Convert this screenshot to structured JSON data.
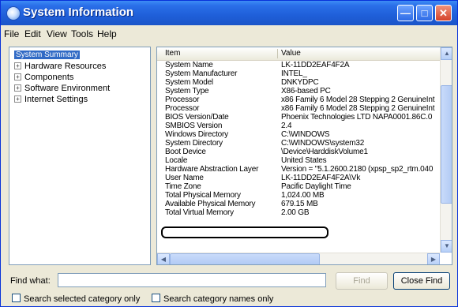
{
  "window": {
    "title": "System Information"
  },
  "menu": [
    "File",
    "Edit",
    "View",
    "Tools",
    "Help"
  ],
  "tree": {
    "root": "System Summary",
    "items": [
      "Hardware Resources",
      "Components",
      "Software Environment",
      "Internet Settings"
    ]
  },
  "table": {
    "headers": {
      "item": "Item",
      "value": "Value"
    },
    "rows": [
      {
        "item": "System Name",
        "value": "LK-11DD2EAF4F2A"
      },
      {
        "item": "System Manufacturer",
        "value": "INTEL_"
      },
      {
        "item": "System Model",
        "value": "DNKYDPC"
      },
      {
        "item": "System Type",
        "value": "X86-based PC"
      },
      {
        "item": "Processor",
        "value": "x86 Family 6 Model 28 Stepping 2 GenuineInt"
      },
      {
        "item": "Processor",
        "value": "x86 Family 6 Model 28 Stepping 2 GenuineInt"
      },
      {
        "item": "BIOS Version/Date",
        "value": "Phoenix Technologies LTD NAPA0001.86C.0"
      },
      {
        "item": "SMBIOS Version",
        "value": "2.4"
      },
      {
        "item": "Windows Directory",
        "value": "C:\\WINDOWS"
      },
      {
        "item": "System Directory",
        "value": "C:\\WINDOWS\\system32"
      },
      {
        "item": "Boot Device",
        "value": "\\Device\\HarddiskVolume1"
      },
      {
        "item": "Locale",
        "value": "United States"
      },
      {
        "item": "Hardware Abstraction Layer",
        "value": "Version = \"5.1.2600.2180 (xpsp_sp2_rtm.040"
      },
      {
        "item": "User Name",
        "value": "LK-11DD2EAF4F2A\\Vk"
      },
      {
        "item": "Time Zone",
        "value": "Pacific Daylight Time"
      },
      {
        "item": "Total Physical Memory",
        "value": "1,024.00 MB"
      },
      {
        "item": "Available Physical Memory",
        "value": "679.15 MB"
      },
      {
        "item": "Total Virtual Memory",
        "value": "2.00 GB"
      }
    ]
  },
  "find": {
    "label": "Find what:",
    "value": "",
    "find_button": "Find",
    "close_button": "Close Find",
    "check_selected": "Search selected category only",
    "check_names": "Search category names only"
  }
}
